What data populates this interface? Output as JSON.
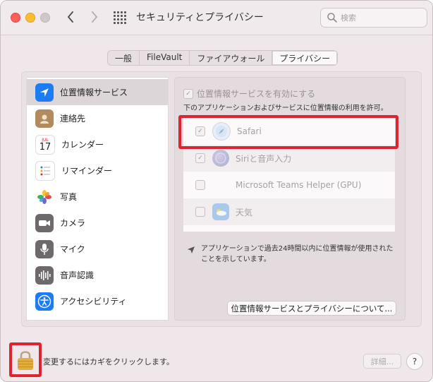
{
  "window": {
    "title": "セキュリティとプライバシー"
  },
  "search": {
    "placeholder": "検索"
  },
  "tabs": [
    {
      "label": "一般"
    },
    {
      "label": "FileVault"
    },
    {
      "label": "ファイアウォール"
    },
    {
      "label": "プライバシー",
      "active": true
    }
  ],
  "sidebar": {
    "items": [
      {
        "label": "位置情報サービス",
        "icon": "location-arrow-icon",
        "selected": true
      },
      {
        "label": "連絡先",
        "icon": "contacts-icon"
      },
      {
        "label": "カレンダー",
        "icon": "calendar-icon",
        "month": "JUL",
        "day": "17"
      },
      {
        "label": "リマインダー",
        "icon": "reminders-icon"
      },
      {
        "label": "写真",
        "icon": "photos-icon"
      },
      {
        "label": "カメラ",
        "icon": "camera-icon"
      },
      {
        "label": "マイク",
        "icon": "microphone-icon"
      },
      {
        "label": "音声認識",
        "icon": "waveform-icon"
      },
      {
        "label": "アクセシビリティ",
        "icon": "accessibility-icon"
      }
    ]
  },
  "location": {
    "enable_label": "位置情報サービスを有効にする",
    "enabled": true,
    "description": "下のアプリケーションおよびサービスに位置情報の利用を許可。",
    "apps": [
      {
        "name": "Safari",
        "checked": true,
        "icon": "safari-icon"
      },
      {
        "name": "Siriと音声入力",
        "checked": true,
        "icon": "siri-icon"
      },
      {
        "name": "Microsoft Teams Helper (GPU)",
        "checked": false,
        "icon": "blank-app-icon"
      },
      {
        "name": "天気",
        "checked": false,
        "icon": "weather-icon"
      }
    ],
    "note": "アプリケーションで過去24時間以内に位置情報が使用されたことを示しています。",
    "about_button": "位置情報サービスとプライバシーについて..."
  },
  "footer": {
    "lock_text": "変更するにはカギをクリックします。",
    "detail_button": "詳細...",
    "help_button": "?"
  },
  "colors": {
    "highlight": "#e0242d",
    "accent": "#1b7cf5"
  }
}
